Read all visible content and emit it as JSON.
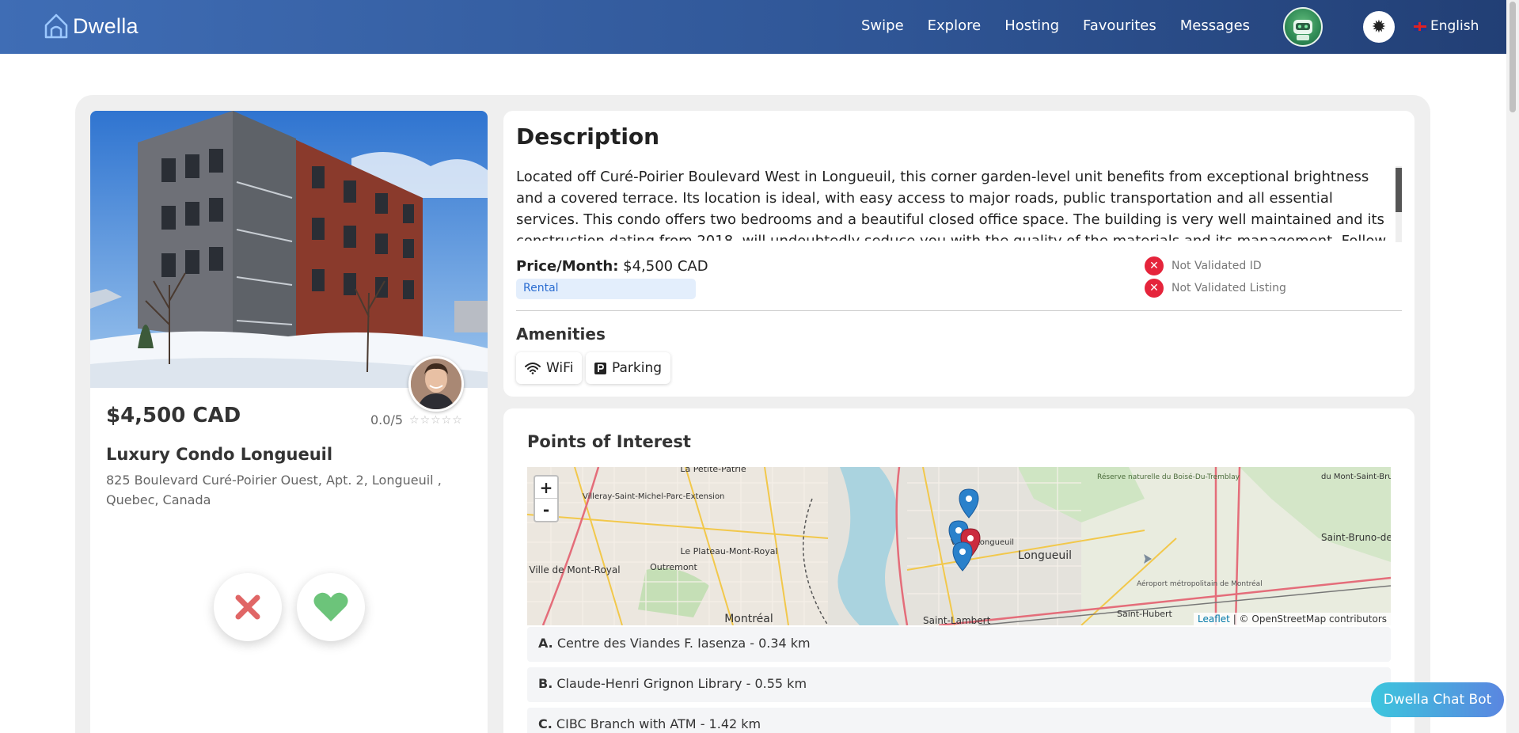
{
  "app": {
    "logo_text": "Dwella"
  },
  "nav": {
    "items": [
      "Swipe",
      "Explore",
      "Hosting",
      "Favourites",
      "Messages"
    ]
  },
  "header": {
    "language": "English"
  },
  "listing": {
    "price": "$4,500 CAD",
    "rating": "0.0/5",
    "stars": "☆☆☆☆☆",
    "title": "Luxury Condo Longueuil",
    "address": "825 Boulevard Curé-Poirier Ouest, Apt. 2, Longueuil , Quebec, Canada"
  },
  "description": {
    "heading": "Description",
    "text": "Located off Curé-Poirier Boulevard West in Longueuil, this corner garden-level unit benefits from exceptional brightness and a covered terrace. Its location is ideal, with easy access to major roads, public transportation and all essential services. This condo offers two bedrooms and a beautiful closed office space. The building is very well maintained and its construction dating from 2018, will undoubtedly seduce you with the quality of the materials and its management. Follow us to the",
    "price_label": "Price/Month:",
    "price_value": "$4,500 CAD",
    "type_badge": "Rental",
    "status_id": "Not Validated ID",
    "status_listing": "Not Validated Listing"
  },
  "amenities": {
    "heading": "Amenities",
    "items": [
      {
        "label": "WiFi",
        "icon": "wifi-icon"
      },
      {
        "label": "Parking",
        "icon": "parking-icon"
      }
    ]
  },
  "poi": {
    "heading": "Points of Interest",
    "zoom_in": "+",
    "zoom_out": "-",
    "attribution_leaflet": "Leaflet",
    "attribution_osm": "| © OpenStreetMap contributors",
    "map_labels": {
      "villeray": "Villeray-Saint-Michel-Parc-Extension",
      "petite_patrie": "La Petite-Patrie",
      "plateau": "Le Plateau-Mont-Royal",
      "outremont": "Outremont",
      "ville_mont_royal": "Ville de Mont-Royal",
      "montreal": "Montréal",
      "vieux_longueuil": "Vieux-Longueuil",
      "longueuil": "Longueuil",
      "saint_lambert": "Saint-Lambert",
      "saint_hubert": "Saint-Hubert",
      "saint_bruno": "Saint-Bruno-de-Montarville",
      "mont_saint_bruno": "du Mont-Saint-Bruno",
      "reserve": "Réserve naturelle du Boisé-Du-Tremblay",
      "aeroport": "Aéroport métropolitain de Montréal"
    },
    "items": [
      {
        "letter": "A.",
        "text": "Centre des Viandes F. Iasenza - 0.34 km"
      },
      {
        "letter": "B.",
        "text": "Claude-Henri Grignon Library - 0.55 km"
      },
      {
        "letter": "C.",
        "text": "CIBC Branch with ATM - 1.42 km"
      }
    ]
  },
  "chatbot": {
    "label": "Dwella Chat Bot"
  },
  "colors": {
    "header": "#2f5595",
    "reject": "#e06666",
    "like": "#6cc47a",
    "badge": "#e3eefc",
    "status_error": "#e5243b"
  }
}
